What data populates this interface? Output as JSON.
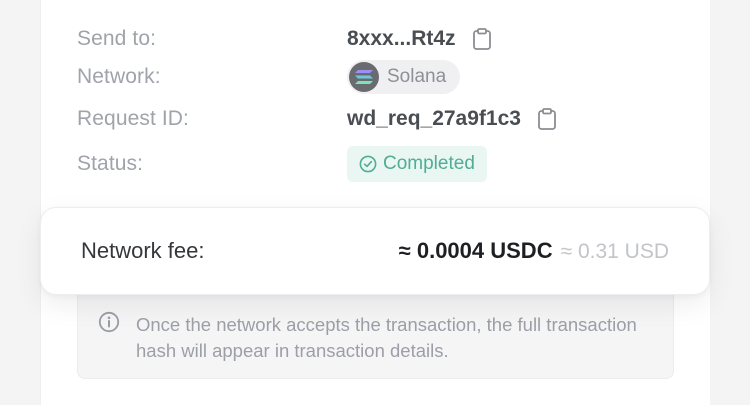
{
  "details": {
    "send_to": {
      "label": "Send to:",
      "value": "8xxx...Rt4z"
    },
    "network": {
      "label": "Network:",
      "value": "Solana"
    },
    "request_id": {
      "label": "Request ID:",
      "value": "wd_req_27a9f1c3"
    },
    "status": {
      "label": "Status:",
      "value": "Completed"
    }
  },
  "fee": {
    "label": "Network fee:",
    "amount": "≈ 0.0004 USDC",
    "fiat": "≈ 0.31 USD"
  },
  "notice": {
    "text": "Once the network accepts the transaction, the full transaction hash will appear in transaction details."
  },
  "colors": {
    "status_accent": "#4fae94",
    "status_bg": "#eaf6f2"
  },
  "icons": {
    "copy": "clipboard-icon",
    "network": "solana-logo-icon",
    "status": "check-circle-icon",
    "notice": "info-icon"
  }
}
